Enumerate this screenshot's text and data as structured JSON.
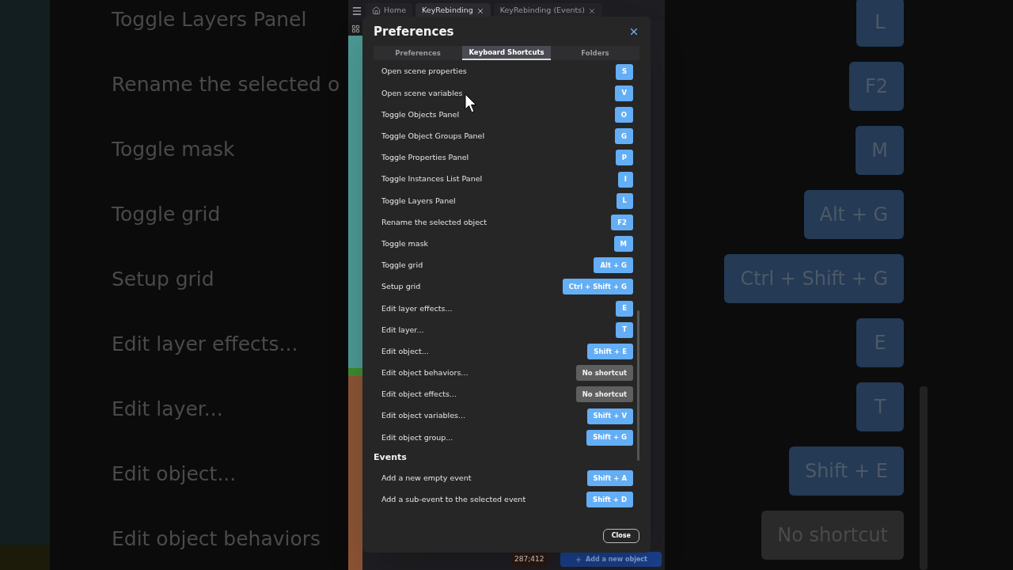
{
  "backdrop": {
    "left_labels": [
      "Toggle Layers Panel",
      "Rename the selected o",
      "Toggle mask",
      "Toggle grid",
      "Setup grid",
      "Edit layer effects...",
      "Edit layer...",
      "Edit object...",
      "Edit object behaviors"
    ],
    "right_keys": [
      {
        "label": "L",
        "kind": "key"
      },
      {
        "label": "F2",
        "kind": "key"
      },
      {
        "label": "M",
        "kind": "key"
      },
      {
        "label": "Alt + G",
        "kind": "key"
      },
      {
        "label": "Ctrl + Shift + G",
        "kind": "key"
      },
      {
        "label": "E",
        "kind": "key"
      },
      {
        "label": "T",
        "kind": "key"
      },
      {
        "label": "Shift + E",
        "kind": "key"
      },
      {
        "label": "No shortcut",
        "kind": "none"
      }
    ]
  },
  "app": {
    "tabs": [
      {
        "label": "Home",
        "kind": "home",
        "selected": false
      },
      {
        "label": "KeyRebinding",
        "kind": "doc",
        "selected": true
      },
      {
        "label": "KeyRebinding (Events)",
        "kind": "doc",
        "selected": false
      }
    ],
    "coordinates": "287;412",
    "add_button": "Add a new object"
  },
  "dialog": {
    "title": "Preferences",
    "tabs": [
      {
        "label": "Preferences",
        "selected": false
      },
      {
        "label": "Keyboard Shortcuts",
        "selected": true
      },
      {
        "label": "Folders",
        "selected": false
      }
    ],
    "shortcuts": [
      {
        "label": "Open scene properties",
        "keys": "S",
        "kind": "key"
      },
      {
        "label": "Open scene variables",
        "keys": "V",
        "kind": "key"
      },
      {
        "label": "Toggle Objects Panel",
        "keys": "O",
        "kind": "key"
      },
      {
        "label": "Toggle Object Groups Panel",
        "keys": "G",
        "kind": "key"
      },
      {
        "label": "Toggle Properties Panel",
        "keys": "P",
        "kind": "key"
      },
      {
        "label": "Toggle Instances List Panel",
        "keys": "I",
        "kind": "key"
      },
      {
        "label": "Toggle Layers Panel",
        "keys": "L",
        "kind": "key"
      },
      {
        "label": "Rename the selected object",
        "keys": "F2",
        "kind": "key"
      },
      {
        "label": "Toggle mask",
        "keys": "M",
        "kind": "key"
      },
      {
        "label": "Toggle grid",
        "keys": "Alt + G",
        "kind": "key"
      },
      {
        "label": "Setup grid",
        "keys": "Ctrl + Shift + G",
        "kind": "key"
      },
      {
        "label": "Edit layer effects...",
        "keys": "E",
        "kind": "key"
      },
      {
        "label": "Edit layer...",
        "keys": "T",
        "kind": "key"
      },
      {
        "label": "Edit object...",
        "keys": "Shift + E",
        "kind": "key"
      },
      {
        "label": "Edit object behaviors...",
        "keys": "No shortcut",
        "kind": "none"
      },
      {
        "label": "Edit object effects...",
        "keys": "No shortcut",
        "kind": "none"
      },
      {
        "label": "Edit object variables...",
        "keys": "Shift + V",
        "kind": "key"
      },
      {
        "label": "Edit object group...",
        "keys": "Shift + G",
        "kind": "key"
      }
    ],
    "sections": [
      {
        "title": "Events",
        "shortcuts": [
          {
            "label": "Add a new empty event",
            "keys": "Shift + A",
            "kind": "key"
          },
          {
            "label": "Add a sub-event to the selected event",
            "keys": "Shift + D",
            "kind": "key"
          }
        ]
      }
    ],
    "close_button": "Close"
  }
}
